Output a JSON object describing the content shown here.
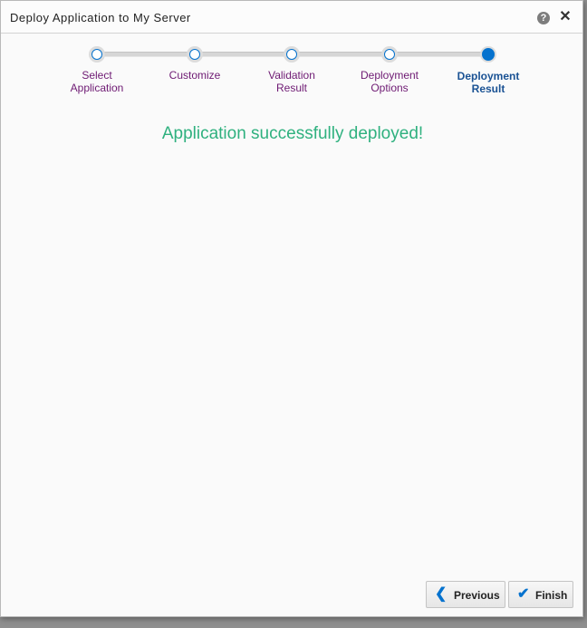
{
  "window": {
    "title": "Deploy Application to My Server"
  },
  "icons": {
    "help": "?",
    "close": "✕",
    "previous": "❮",
    "finish": "✔"
  },
  "train": {
    "steps": [
      {
        "label": "Select\nApplication",
        "state": "visited"
      },
      {
        "label": "Customize",
        "state": "visited"
      },
      {
        "label": "Validation\nResult",
        "state": "visited"
      },
      {
        "label": "Deployment\nOptions",
        "state": "visited"
      },
      {
        "label": "Deployment\nResult",
        "state": "current"
      }
    ]
  },
  "main": {
    "message": "Application successfully deployed!"
  },
  "buttons": {
    "previous": "Previous",
    "finish": "Finish"
  },
  "colors": {
    "accent": "#0572ce",
    "success": "#2fb17f",
    "visited_label": "#6e1a73",
    "current_label": "#1a5294"
  }
}
